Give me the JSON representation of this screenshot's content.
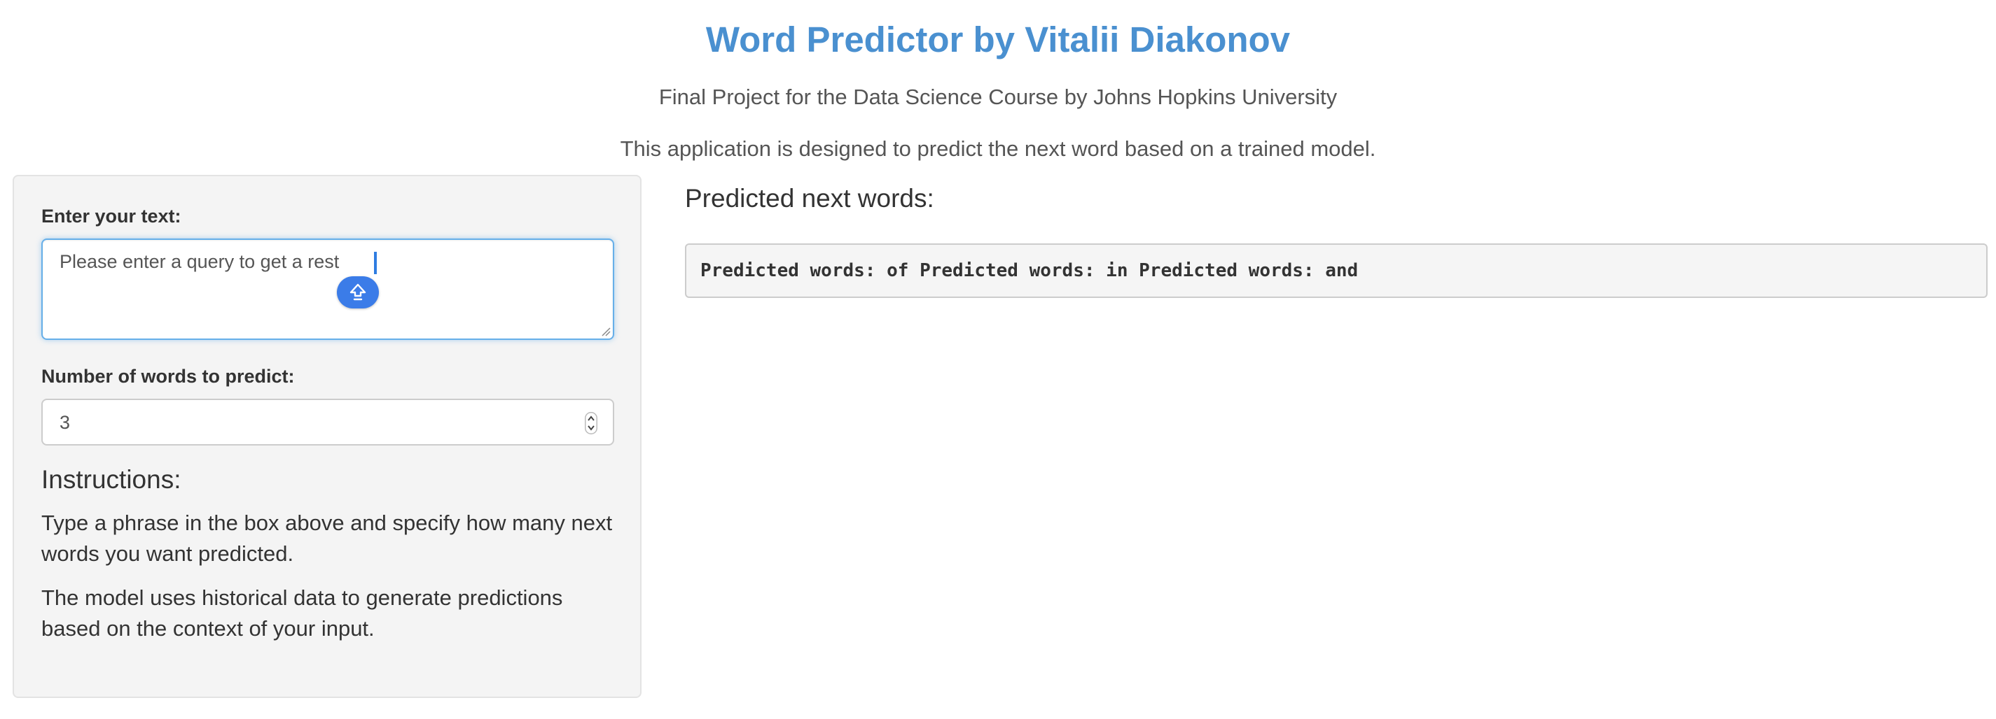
{
  "header": {
    "title": "Word Predictor by Vitalii Diakonov",
    "subtitle": "Final Project for the Data Science Course by Johns Hopkins University",
    "description": "This application is designed to predict the next word based on a trained model."
  },
  "sidebar": {
    "text_label": "Enter your text:",
    "text_value": "Please enter a query to get a rest",
    "number_label": "Number of words to predict:",
    "number_value": "3",
    "instructions_heading": "Instructions:",
    "instructions": [
      "Type a phrase in the box above and specify how many next words you want predicted.",
      "The model uses historical data to generate predictions based on the context of your input."
    ]
  },
  "main": {
    "heading": "Predicted next words:",
    "output": "Predicted words: of Predicted words: in Predicted words: and"
  },
  "icons": {
    "upload": "upload-arrow-icon",
    "spinner": "spinner-icon",
    "resize": "resize-handle-icon"
  },
  "colors": {
    "title": "#4a90d0",
    "focus_border": "#66afe9",
    "bubble": "#3b7ce8",
    "panel_bg": "#f4f4f4"
  }
}
